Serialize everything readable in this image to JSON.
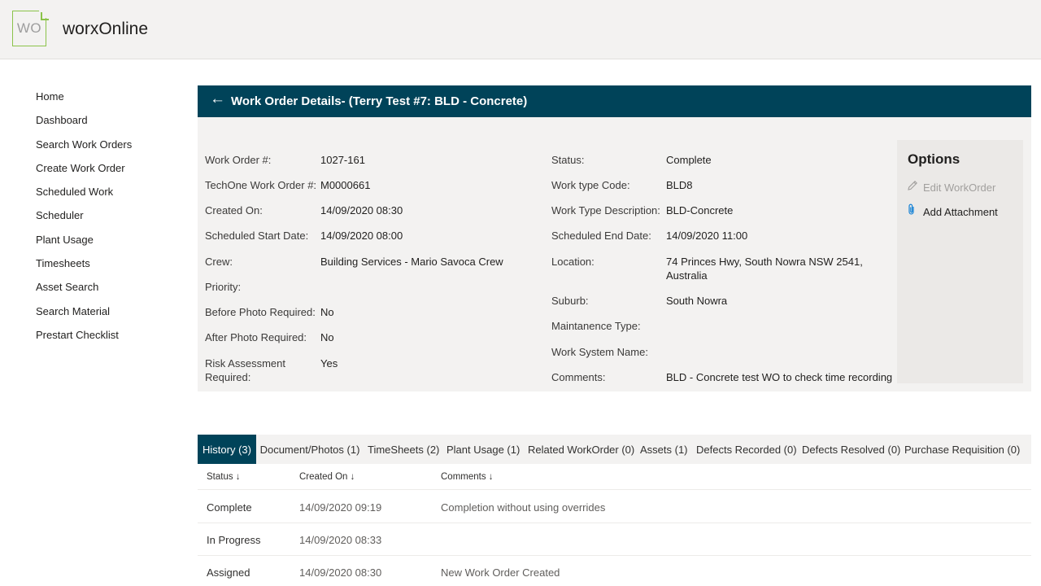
{
  "app": {
    "logo_text": "WO",
    "title": "worxOnline"
  },
  "nav": [
    "Home",
    "Dashboard",
    "Search Work Orders",
    "Create Work Order",
    "Scheduled Work",
    "Scheduler",
    "Plant Usage",
    "Timesheets",
    "Asset Search",
    "Search Material",
    "Prestart Checklist"
  ],
  "header": {
    "back_icon": "←",
    "title": "Work Order Details- (Terry Test #7: BLD - Concrete)"
  },
  "left_fields": [
    {
      "label": "Work Order #:",
      "value": "1027-161"
    },
    {
      "label": "TechOne Work Order #:",
      "value": "M0000661"
    },
    {
      "label": "Created On:",
      "value": "14/09/2020 08:30"
    },
    {
      "label": "Scheduled Start Date:",
      "value": "14/09/2020 08:00"
    },
    {
      "label": "Crew:",
      "value": "Building Services - Mario Savoca Crew"
    },
    {
      "label": "Priority:",
      "value": ""
    },
    {
      "label": "Before Photo Required:",
      "value": "No"
    },
    {
      "label": "After Photo Required:",
      "value": "No"
    },
    {
      "label": "Risk Assessment Required:",
      "value": "Yes"
    }
  ],
  "right_fields": [
    {
      "label": "Status:",
      "value": "Complete"
    },
    {
      "label": "Work type Code:",
      "value": "BLD8"
    },
    {
      "label": "Work Type Description:",
      "value": "BLD-Concrete"
    },
    {
      "label": "Scheduled End Date:",
      "value": "14/09/2020 11:00"
    },
    {
      "label": "Location:",
      "value": "74 Princes Hwy, South Nowra NSW 2541, Australia"
    },
    {
      "label": "Suburb:",
      "value": "South Nowra"
    },
    {
      "label": "Maintanence Type:",
      "value": ""
    },
    {
      "label": "Work System Name:",
      "value": ""
    },
    {
      "label": "Comments:",
      "value": "BLD - Concrete test WO to check time recording"
    }
  ],
  "options": {
    "title": "Options",
    "edit_label": "Edit WorkOrder",
    "edit_icon": "pencil-icon",
    "attach_label": "Add Attachment",
    "attach_icon": "paperclip-icon"
  },
  "tabs": [
    "History (3)",
    "Document/Photos (1)",
    "TimeSheets (2)",
    "Plant Usage (1)",
    "Related WorkOrder (0)",
    "Assets (1)",
    "Defects Recorded (0)",
    "Defects Resolved (0)",
    "Purchase Requisition (0)"
  ],
  "active_tab": "History (3)",
  "history": {
    "columns": [
      "Status ↓",
      "Created On ↓",
      "Comments ↓"
    ],
    "rows": [
      {
        "status": "Complete",
        "created": "14/09/2020 09:19",
        "comment": "Completion without using overrides"
      },
      {
        "status": "In Progress",
        "created": "14/09/2020 08:33",
        "comment": ""
      },
      {
        "status": "Assigned",
        "created": "14/09/2020 08:30",
        "comment": "New Work Order Created"
      }
    ]
  },
  "colors": {
    "accent": "#004359",
    "panel": "#f3f2f1",
    "logo_green": "#8bc34a",
    "link_blue": "#0078d4"
  }
}
